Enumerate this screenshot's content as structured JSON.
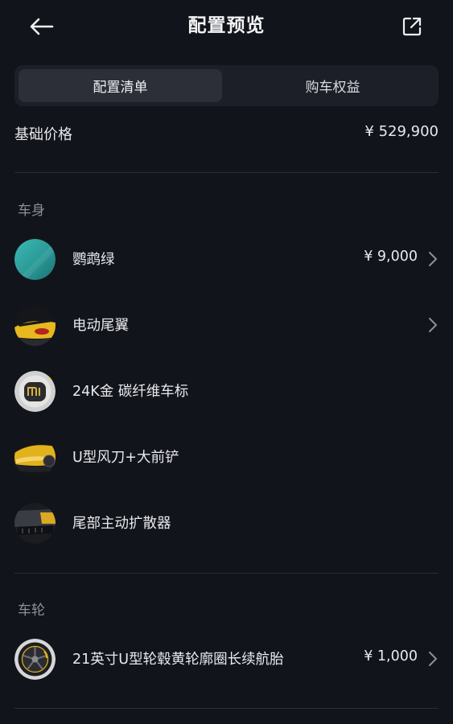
{
  "header": {
    "title": "配置预览",
    "back_icon": "arrow-left-icon",
    "share_icon": "share-external-icon"
  },
  "tabs": [
    {
      "label": "配置清单",
      "active": true
    },
    {
      "label": "购车权益",
      "active": false
    }
  ],
  "base_price": {
    "label": "基础价格",
    "value": "¥ 529,900"
  },
  "sections": [
    {
      "title": "车身",
      "items": [
        {
          "name": "鹦鹉绿",
          "price": "¥ 9,000",
          "has_chevron": true,
          "thumb": "teal-paint-swatch"
        },
        {
          "name": "电动尾翼",
          "price": "",
          "has_chevron": true,
          "thumb": "rear-wing-photo"
        },
        {
          "name": "24K金 碳纤维车标",
          "price": "",
          "has_chevron": false,
          "thumb": "mi-logo-badge"
        },
        {
          "name": "U型风刀+大前铲",
          "price": "",
          "has_chevron": false,
          "thumb": "front-splitter-photo"
        },
        {
          "name": "尾部主动扩散器",
          "price": "",
          "has_chevron": false,
          "thumb": "rear-diffuser-photo"
        }
      ]
    },
    {
      "title": "车轮",
      "items": [
        {
          "name": "21英寸U型轮毂黄轮廓圈长续航胎",
          "price": "¥ 1,000",
          "has_chevron": true,
          "thumb": "wheel-photo"
        }
      ]
    }
  ],
  "colors": {
    "background": "#12141b",
    "tab_bar": "#1c1f27",
    "tab_active": "#2c2f37",
    "text_primary": "#e8e9ed",
    "text_secondary": "#8c8f98",
    "accent_yellow": "#f2c230",
    "paint_teal": "#2fa3a0"
  }
}
